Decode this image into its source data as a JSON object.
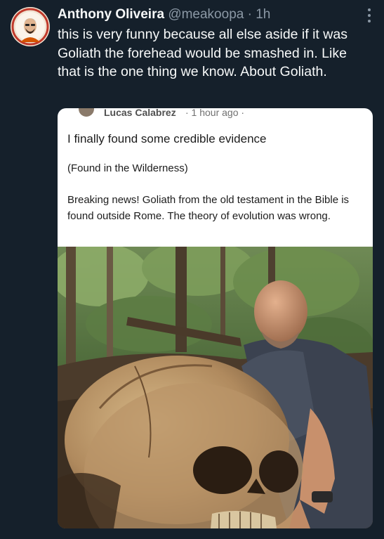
{
  "tweet": {
    "author_name": "Anthony Oliveira",
    "handle": "@meakoopa",
    "separator": "·",
    "time": "1h",
    "text": "this is very funny because all else aside if it was Goliath the forehead would be smashed in. Like that is the one thing we know. About Goliath."
  },
  "embedded_post": {
    "poster_name": "Lucas Calabrez",
    "meta": "· 1 hour ago ·",
    "title": "I finally found some credible evidence",
    "subtitle": "(Found in the Wilderness)",
    "body": "Breaking news! Goliath from the old testament in the Bible is found outside Rome.  The theory of evolution was wrong."
  },
  "icons": {
    "more": "more-dots-icon",
    "audience": "globe-icon"
  },
  "colors": {
    "background": "#15202b",
    "primary_text": "#f7f9f9",
    "secondary_text": "#8b98a5",
    "card_background": "#ffffff"
  }
}
